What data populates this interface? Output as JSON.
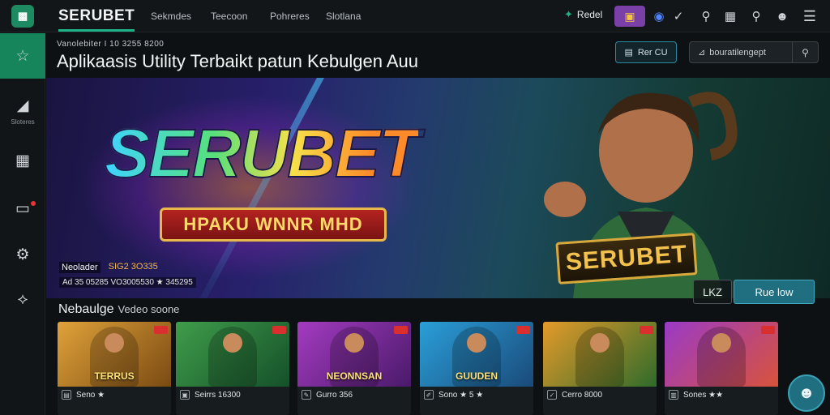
{
  "app": {
    "logo_glyph": "▩",
    "brand": "SERUBET",
    "nav": [
      "Sekmdes",
      "Teecoon",
      "Pohreres",
      "Slotlana"
    ],
    "top_right_label": "Redel",
    "colors": {
      "accent": "#1db388",
      "gift": "#7b3fa8",
      "primary_btn": "#1f6f80"
    }
  },
  "sidebar": {
    "items": [
      {
        "icon": "star-icon",
        "label": ""
      },
      {
        "icon": "chart-icon",
        "label": "Sloteres"
      },
      {
        "icon": "calculator-icon",
        "label": ""
      },
      {
        "icon": "screen-icon",
        "label": ""
      },
      {
        "icon": "gear-icon",
        "label": ""
      },
      {
        "icon": "diamond-icon",
        "label": ""
      }
    ]
  },
  "header": {
    "small": "Vanolebiter I 10 3255 8200",
    "title": "Aplikaasis Utility Terbaikt patun Kebulgen Auu",
    "save_button": "Rer CU",
    "search_placeholder": "bouratilengept"
  },
  "hero": {
    "logo": "SERUBET",
    "ribbon": "HPAKU WNNR MHD",
    "tag_a": "Neolader",
    "tag_b": "SIG2 3O335",
    "tag_line": "Ad 35 05285 VO3005530 ★ 345295",
    "badge": "SERUBET",
    "btn_prev": "LKZ",
    "btn_main": "Rue low"
  },
  "games_section": {
    "title": "Nebaulge",
    "subtitle": "Vedeo soone",
    "cards": [
      {
        "title": "TERRUS",
        "meta": "Seno ★",
        "icon": "document-icon",
        "colors": [
          "#e0a23a",
          "#7a4a12"
        ]
      },
      {
        "title": "",
        "meta": "Seirrs 16300",
        "icon": "wallet-icon",
        "colors": [
          "#3f9d4a",
          "#15502a"
        ]
      },
      {
        "title": "NEONNSAN",
        "meta": "Gurro 356",
        "icon": "pencil-icon",
        "colors": [
          "#a43bc0",
          "#4a1a6a"
        ]
      },
      {
        "title": "GUUDEN",
        "meta": "Sono ★ 5 ★",
        "icon": "edit-icon",
        "colors": [
          "#2a9fd8",
          "#1a4a7a"
        ]
      },
      {
        "title": "",
        "meta": "Cerro 8000",
        "icon": "tag-icon",
        "colors": [
          "#e59a2a",
          "#2e6b2a"
        ]
      },
      {
        "title": "",
        "meta": "Sones ★★",
        "icon": "chart-icon",
        "colors": [
          "#9a3ac8",
          "#d8533a"
        ]
      }
    ]
  }
}
